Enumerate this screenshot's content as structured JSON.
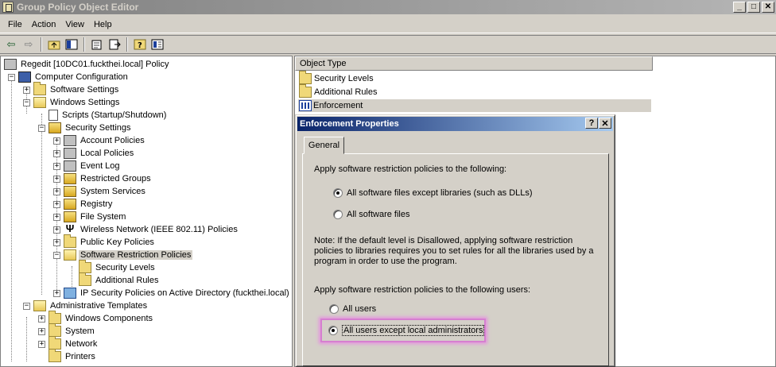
{
  "window": {
    "title": "Group Policy Object Editor",
    "min": "_",
    "max": "□",
    "close": "✕"
  },
  "menu": [
    {
      "label": "File"
    },
    {
      "label": "Action"
    },
    {
      "label": "View"
    },
    {
      "label": "Help"
    }
  ],
  "toolbar": [
    "back-icon",
    "forward-icon",
    "up-folder-icon",
    "show-hide-tree-icon",
    "properties-icon",
    "export-icon",
    "help-icon",
    "console-icon"
  ],
  "tree": {
    "root": "Regedit [10DC01.fuckthei.local] Policy",
    "items": {
      "computer_config": "Computer Configuration",
      "software_settings": "Software Settings",
      "windows_settings": "Windows Settings",
      "scripts": "Scripts (Startup/Shutdown)",
      "security_settings": "Security Settings",
      "account_policies": "Account Policies",
      "local_policies": "Local Policies",
      "event_log": "Event Log",
      "restricted_groups": "Restricted Groups",
      "system_services": "System Services",
      "registry": "Registry",
      "file_system": "File System",
      "wireless": "Wireless Network (IEEE 802.11) Policies",
      "public_key": "Public Key Policies",
      "srp": "Software Restriction Policies",
      "security_levels": "Security Levels",
      "additional_rules": "Additional Rules",
      "ipsec": "IP Security Policies on Active Directory (fuckthei.local)",
      "admin_templates": "Administrative Templates",
      "windows_components": "Windows Components",
      "system": "System",
      "network": "Network",
      "printers": "Printers"
    }
  },
  "list": {
    "header": "Object Type",
    "items": [
      "Security Levels",
      "Additional Rules",
      "Enforcement"
    ]
  },
  "dialog": {
    "title": "Enforcement Properties",
    "help_btn": "?",
    "close_btn": "✕",
    "tab": "General",
    "apply_label": "Apply software restriction policies to the following:",
    "option_except_libs": "All software files except libraries (such as DLLs)",
    "option_all_files": "All software files",
    "note": "Note:  If the default level is Disallowed, applying software restriction policies to libraries requires you to set rules for all the libraries used by a program in order to use the program.",
    "users_label": "Apply software restriction policies to the following users:",
    "option_all_users": "All users",
    "option_except_admins": "All users except local administrators",
    "selected_files_option": "except_libs",
    "selected_users_option": "except_admins"
  },
  "colors": {
    "highlight": "#d67fd0",
    "titlebar_active": "#0a246a"
  }
}
